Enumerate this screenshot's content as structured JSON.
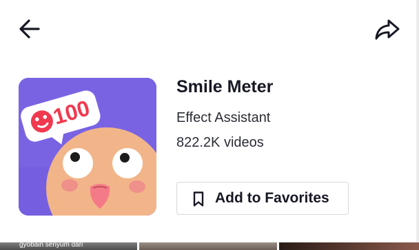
{
  "header": {
    "back_icon": "arrow-left-icon",
    "share_icon": "share-arrow-icon"
  },
  "effect": {
    "thumbnail_icon": "smile-meter-thumbnail",
    "thumbnail_badge_number": "100",
    "name": "Smile Meter",
    "creator": "Effect Assistant",
    "video_count": "822.2K videos"
  },
  "favorites_button": {
    "icon": "bookmark-icon",
    "label": "Add to Favorites"
  },
  "video_strip": {
    "tiles": [
      {
        "caption": "gyobain senyum dari"
      },
      {
        "caption": ""
      },
      {
        "caption": ""
      }
    ]
  },
  "colors": {
    "thumb_bg": "#7a63e3",
    "badge_red": "#f0394f",
    "text_primary": "#161823"
  }
}
